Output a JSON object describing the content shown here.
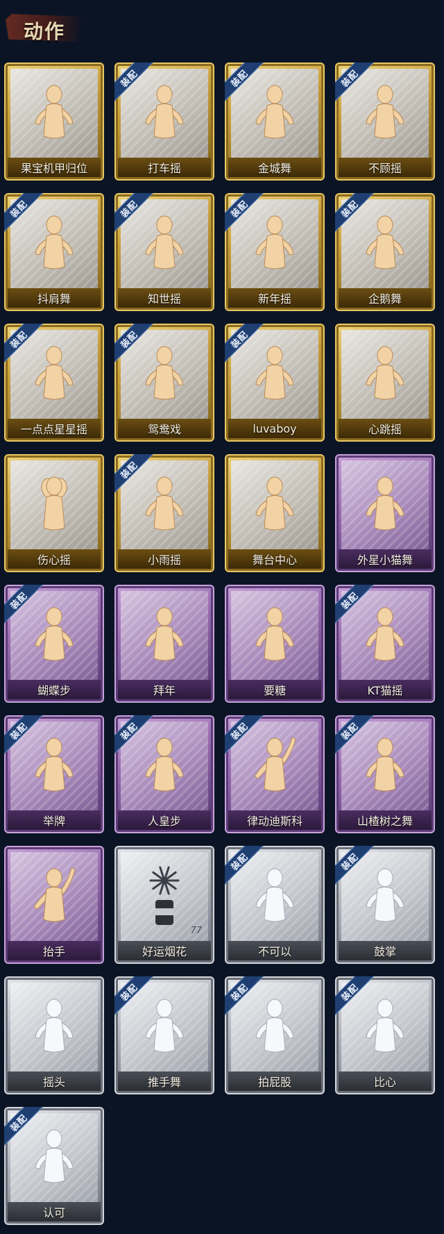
{
  "header": {
    "title": "动作"
  },
  "equipped_badge_text": "装配",
  "colors": {
    "gold_frame": "#c9a03e",
    "purple_frame": "#9b6eb3",
    "gray_frame": "#b5b9c1",
    "badge_blue": "#1f3f72",
    "background": "#0b1424"
  },
  "cards": [
    {
      "label": "果宝机甲归位",
      "tier": "gold",
      "equipped": false,
      "icon": "dance-pose-icon"
    },
    {
      "label": "打车摇",
      "tier": "gold",
      "equipped": true,
      "icon": "dance-pose-icon"
    },
    {
      "label": "金城舞",
      "tier": "gold",
      "equipped": true,
      "icon": "dance-pose-icon"
    },
    {
      "label": "不顾摇",
      "tier": "gold",
      "equipped": true,
      "icon": "dance-pose-icon"
    },
    {
      "label": "抖肩舞",
      "tier": "gold",
      "equipped": true,
      "icon": "dance-pose-icon"
    },
    {
      "label": "知世摇",
      "tier": "gold",
      "equipped": true,
      "icon": "dance-pose-icon"
    },
    {
      "label": "新年摇",
      "tier": "gold",
      "equipped": true,
      "icon": "dance-pose-icon"
    },
    {
      "label": "企鹅舞",
      "tier": "gold",
      "equipped": true,
      "icon": "dance-pose-icon"
    },
    {
      "label": "一点点星星摇",
      "tier": "gold",
      "equipped": true,
      "icon": "dance-pose-icon"
    },
    {
      "label": "鸳鸯戏",
      "tier": "gold",
      "equipped": true,
      "icon": "dance-pose-icon"
    },
    {
      "label": "luvaboy",
      "tier": "gold",
      "equipped": true,
      "icon": "dance-pose-icon"
    },
    {
      "label": "心跳摇",
      "tier": "gold",
      "equipped": false,
      "icon": "dance-pose-icon"
    },
    {
      "label": "伤心摇",
      "tier": "gold",
      "equipped": false,
      "icon": "heart-hands-pose-icon"
    },
    {
      "label": "小雨摇",
      "tier": "gold",
      "equipped": true,
      "icon": "dance-pose-icon"
    },
    {
      "label": "舞台中心",
      "tier": "gold",
      "equipped": false,
      "icon": "dance-pose-icon"
    },
    {
      "label": "外星小猫舞",
      "tier": "purple",
      "equipped": false,
      "icon": "dance-pose-icon"
    },
    {
      "label": "蝴蝶步",
      "tier": "purple",
      "equipped": true,
      "icon": "dance-pose-icon"
    },
    {
      "label": "拜年",
      "tier": "purple",
      "equipped": false,
      "icon": "bow-pose-icon"
    },
    {
      "label": "要糖",
      "tier": "purple",
      "equipped": false,
      "icon": "reach-pose-icon"
    },
    {
      "label": "KT猫摇",
      "tier": "purple",
      "equipped": true,
      "icon": "dance-pose-icon"
    },
    {
      "label": "举牌",
      "tier": "purple",
      "equipped": true,
      "icon": "sign-pose-icon"
    },
    {
      "label": "人皇步",
      "tier": "purple",
      "equipped": true,
      "icon": "dance-pose-icon"
    },
    {
      "label": "律动迪斯科",
      "tier": "purple",
      "equipped": true,
      "icon": "disco-pose-icon"
    },
    {
      "label": "山楂树之舞",
      "tier": "purple",
      "equipped": true,
      "icon": "dance-pose-icon"
    },
    {
      "label": "抬手",
      "tier": "purple",
      "equipped": false,
      "icon": "raise-hand-pose-icon"
    },
    {
      "label": "好运烟花",
      "tier": "gray",
      "equipped": false,
      "icon": "firework-icon",
      "count": "77"
    },
    {
      "label": "不可以",
      "tier": "gray",
      "equipped": true,
      "icon": "finger-wag-icon"
    },
    {
      "label": "鼓掌",
      "tier": "gray",
      "equipped": true,
      "icon": "clap-icon"
    },
    {
      "label": "摇头",
      "tier": "gray",
      "equipped": false,
      "icon": "head-shake-pose-icon"
    },
    {
      "label": "推手舞",
      "tier": "gray",
      "equipped": true,
      "icon": "push-pose-icon"
    },
    {
      "label": "拍屁股",
      "tier": "gray",
      "equipped": true,
      "icon": "spank-pose-icon"
    },
    {
      "label": "比心",
      "tier": "gray",
      "equipped": true,
      "icon": "finger-heart-icon"
    },
    {
      "label": "认可",
      "tier": "gray",
      "equipped": true,
      "icon": "thumbs-up-icon"
    }
  ]
}
